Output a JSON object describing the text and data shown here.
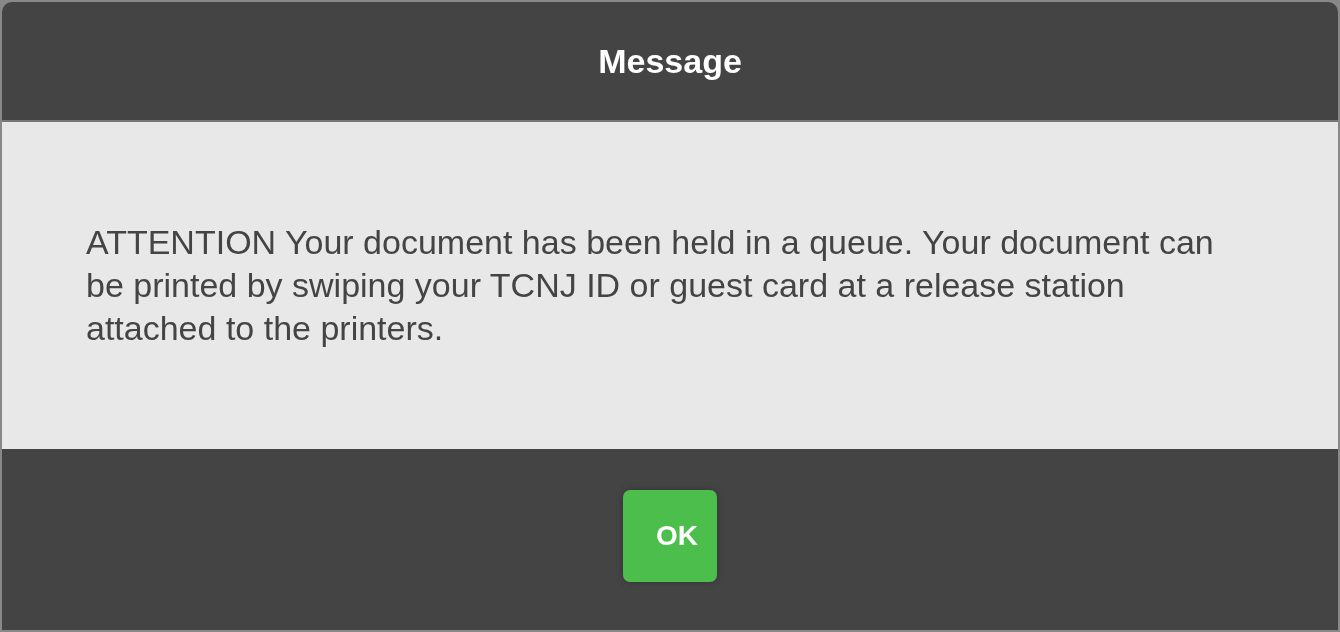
{
  "dialog": {
    "title": "Message",
    "message": "ATTENTION Your document has been held in a queue. Your document can be printed by swiping your TCNJ ID or guest card at a release station attached to the printers.",
    "buttons": [
      {
        "label": "OK",
        "kind": "primary"
      }
    ]
  }
}
